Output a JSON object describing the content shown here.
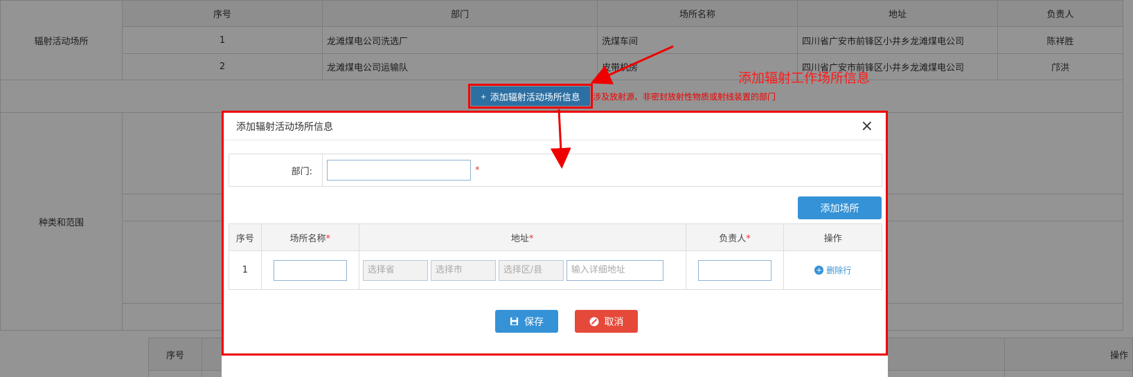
{
  "bg": {
    "section_1_label": "辐射活动场所",
    "section_2_label": "种类和范围",
    "headers": [
      "序号",
      "部门",
      "场所名称",
      "地址",
      "负责人"
    ],
    "rows": [
      {
        "no": "1",
        "dept": "龙滩煤电公司洗选厂",
        "site": "洗煤车间",
        "addr": "四川省广安市前锋区小井乡龙滩煤电公司",
        "owner": "陈祥胜"
      },
      {
        "no": "2",
        "dept": "龙滩煤电公司运输队",
        "site": "皮带机房",
        "addr": "四川省广安市前锋区小井乡龙滩煤电公司",
        "owner": "邝洪"
      }
    ],
    "add_button_label": "添加辐射活动场所信息",
    "add_button_icon": "+",
    "add_button_note": "涉及放射源、非密封放射性物质或射线装置的部门",
    "bottom_header_no": "序号",
    "bottom_header_op": "操作"
  },
  "annotation": {
    "text": "添加辐射工作场所信息",
    "color": "#ff1a1a"
  },
  "modal": {
    "title": "添加辐射活动场所信息",
    "close_icon": "×",
    "dept_label": "部门:",
    "dept_value": "",
    "required_mark": "*",
    "add_site_label": "添加场所",
    "table_headers": {
      "no": "序号",
      "site_name": "场所名称",
      "address": "地址",
      "owner": "负责人",
      "op": "操作"
    },
    "row": {
      "no": "1",
      "site_name": "",
      "province_placeholder": "选择省",
      "city_placeholder": "选择市",
      "district_placeholder": "选择区/县",
      "detail_placeholder": "输入详细地址",
      "owner": "",
      "delete_label": "删除行"
    },
    "save_label": "保存",
    "cancel_label": "取消"
  },
  "colors": {
    "primary": "#3592d6",
    "danger": "#e5493a",
    "highlight": "#ee0000",
    "dark_button": "#2c6fa3"
  }
}
